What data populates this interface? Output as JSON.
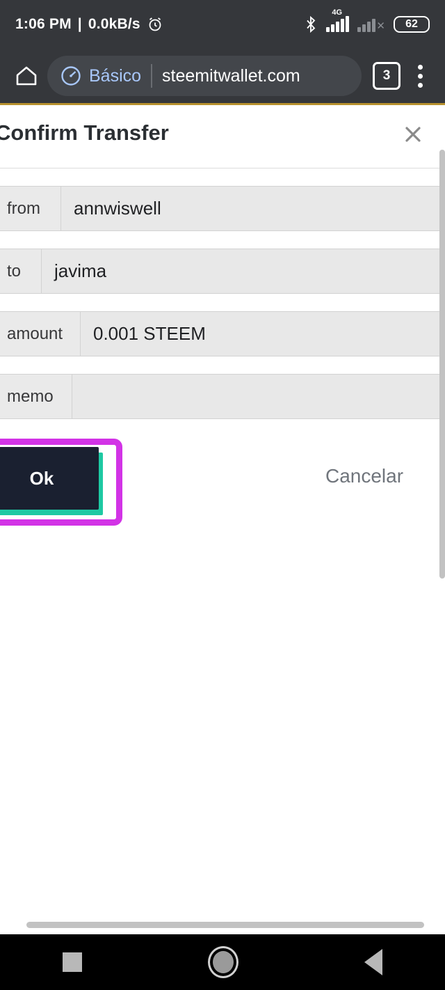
{
  "status_bar": {
    "time": "1:06 PM",
    "separator": "|",
    "network_speed": "0.0kB/s",
    "alarm_icon": "alarm-clock-icon",
    "bluetooth_icon": "bluetooth-icon",
    "network_type": "4G",
    "sim2_state": "no-service",
    "battery_level": "62"
  },
  "browser": {
    "home_icon": "home-icon",
    "mode_icon": "speedometer-icon",
    "mode_label": "Básico",
    "url": "steemitwallet.com",
    "tab_count": "3",
    "menu_icon": "overflow-menu-icon"
  },
  "dialog": {
    "title": "Confirm Transfer",
    "close_icon": "close-icon",
    "fields": [
      {
        "label": "from",
        "value": "annwiswell"
      },
      {
        "label": "to",
        "value": "javima"
      },
      {
        "label": "amount",
        "value": "0.001 STEEM"
      },
      {
        "label": "memo",
        "value": ""
      }
    ],
    "ok_label": "Ok",
    "cancel_label": "Cancelar"
  },
  "colors": {
    "highlight_magenta": "#d233e6",
    "button_teal": "#1ec9a3",
    "button_dark": "#1a2030",
    "accent_blue": "#a8c7fa",
    "progress_gold": "#b8912e"
  },
  "navigation": {
    "recents_icon": "square-recents-icon",
    "home_icon": "circle-home-icon",
    "back_icon": "triangle-back-icon"
  }
}
